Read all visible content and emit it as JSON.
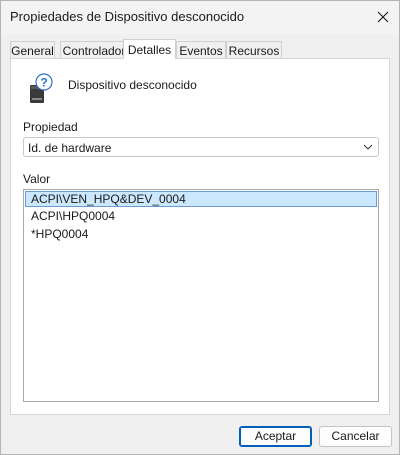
{
  "window": {
    "title": "Propiedades de Dispositivo desconocido",
    "close_icon": "close-icon"
  },
  "tabs": [
    {
      "label": "General",
      "active": false
    },
    {
      "label": "Controlador",
      "active": false
    },
    {
      "label": "Detalles",
      "active": true
    },
    {
      "label": "Eventos",
      "active": false
    },
    {
      "label": "Recursos",
      "active": false
    }
  ],
  "details": {
    "device_icon": "unknown-device-icon",
    "device_name": "Dispositivo desconocido",
    "property_label": "Propiedad",
    "property_selected": "Id. de hardware",
    "value_label": "Valor",
    "values": [
      {
        "text": "ACPI\\VEN_HPQ&DEV_0004",
        "selected": true
      },
      {
        "text": "ACPI\\HPQ0004",
        "selected": false
      },
      {
        "text": "*HPQ0004",
        "selected": false
      }
    ]
  },
  "buttons": {
    "accept_label": "Aceptar",
    "cancel_label": "Cancelar"
  },
  "colors": {
    "selection_fill": "#cce8ff",
    "selection_border": "#6c9bd2",
    "default_button_border": "#005fb8"
  }
}
